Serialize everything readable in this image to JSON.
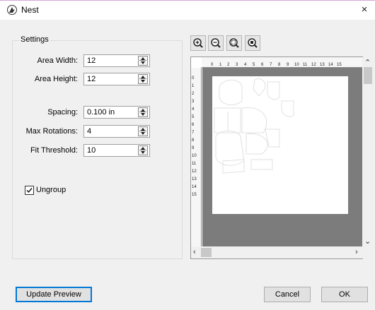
{
  "window": {
    "title": "Nest",
    "close_glyph": "×"
  },
  "settings": {
    "group_title": "Settings",
    "fields": [
      {
        "label": "Area Width:",
        "value": "12"
      },
      {
        "label": "Area Height:",
        "value": "12"
      },
      {
        "label": "Spacing:",
        "value": "0.100 in"
      },
      {
        "label": "Max Rotations:",
        "value": "4"
      },
      {
        "label": "Fit Threshold:",
        "value": "10"
      }
    ],
    "ungroup": {
      "label": "Ungroup",
      "checked": true
    }
  },
  "preview": {
    "zoom_buttons": [
      "zoom-in-icon",
      "zoom-out-icon",
      "zoom-fit-icon",
      "zoom-selection-icon"
    ],
    "ruler_top": [
      "0",
      "1",
      "2",
      "3",
      "4",
      "5",
      "6",
      "7",
      "8",
      "9",
      "10",
      "11",
      "12",
      "13",
      "14",
      "15"
    ],
    "ruler_left": [
      "0",
      "1",
      "2",
      "3",
      "4",
      "5",
      "6",
      "7",
      "8",
      "9",
      "10",
      "11",
      "12",
      "13",
      "14",
      "15"
    ]
  },
  "buttons": {
    "update_preview": "Update Preview",
    "cancel": "Cancel",
    "ok": "OK"
  },
  "colors": {
    "mat_background": "#7c7c7c",
    "accent": "#0078d7"
  }
}
